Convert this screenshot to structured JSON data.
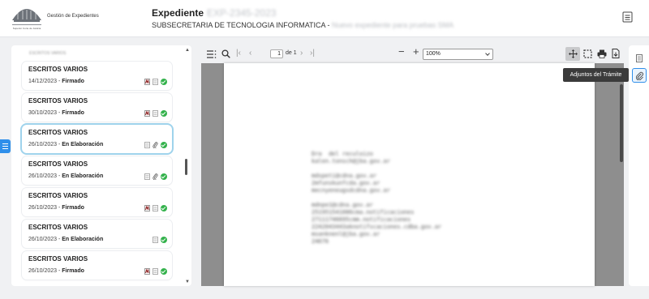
{
  "header": {
    "app_name": "Gestión de Expedientes",
    "logo_caption": "Superior Corte de Justicia",
    "title": "Expediente",
    "title_number": "EXP-2345-2023",
    "subtitle": "SUBSECRETARIA DE TECNOLOGIA INFORMATICA - ",
    "subtitle_detail": "Nuevo expediente para pruebas SMA"
  },
  "documents_list": {
    "top_blurred": "ESCRITOS VARIOS",
    "items": [
      {
        "title": "ESCRITOS VARIOS",
        "date": "14/12/2023 - ",
        "status": "Firmado",
        "icons": [
          "signature-icon",
          "document-icon",
          "signed-check-icon"
        ]
      },
      {
        "title": "ESCRITOS VARIOS",
        "date": "30/10/2023 - ",
        "status": "Firmado",
        "icons": [
          "signature-icon",
          "document-icon",
          "signed-check-icon"
        ]
      },
      {
        "title": "ESCRITOS VARIOS",
        "date": "26/10/2023 - ",
        "status": "En Elaboración",
        "icons": [
          "document-icon",
          "attachment-icon",
          "signed-check-icon"
        ]
      },
      {
        "title": "ESCRITOS VARIOS",
        "date": "26/10/2023 - ",
        "status": "En Elaboración",
        "icons": [
          "document-icon",
          "attachment-icon",
          "signed-check-icon"
        ]
      },
      {
        "title": "ESCRITOS VARIOS",
        "date": "26/10/2023 - ",
        "status": "Firmado",
        "icons": [
          "signature-icon",
          "document-icon",
          "signed-check-icon"
        ]
      },
      {
        "title": "ESCRITOS VARIOS",
        "date": "26/10/2023 - ",
        "status": "En Elaboración",
        "icons": [
          "document-icon",
          "signed-check-icon"
        ]
      },
      {
        "title": "ESCRITOS VARIOS",
        "date": "26/10/2023 - ",
        "status": "Firmado",
        "icons": [
          "signature-icon",
          "document-icon",
          "signed-check-icon"
        ]
      }
    ]
  },
  "viewer": {
    "page_current": "1",
    "page_of": "de 1",
    "zoom": "100%",
    "document_lines": [
      "Dra  del reculoizo",
      "kalen.tonsch@jba.gov.ar",
      "",
      "mdspeti@cdna.gov.ar",
      "2mfunskunfcda.gov.ar",
      "mecnyeneugsdcdna.gov.ar",
      "",
      "mdnpe1@cdna.gov.ar",
      "251951541086cma.notificaciones",
      "27111746695cmm.notificaciones",
      "2242043443aknotifscaciones.cdba.gov.ar",
      "msanknenl@jba.gov.ar",
      "24676"
    ]
  },
  "right_rail": {
    "tooltip": "Adjuntos del Trámite"
  },
  "colors": {
    "accent": "#2f8fea",
    "signed_green": "#34b24c",
    "selected_border": "#9fd3ec",
    "signature_red": "#8b1a1a"
  }
}
